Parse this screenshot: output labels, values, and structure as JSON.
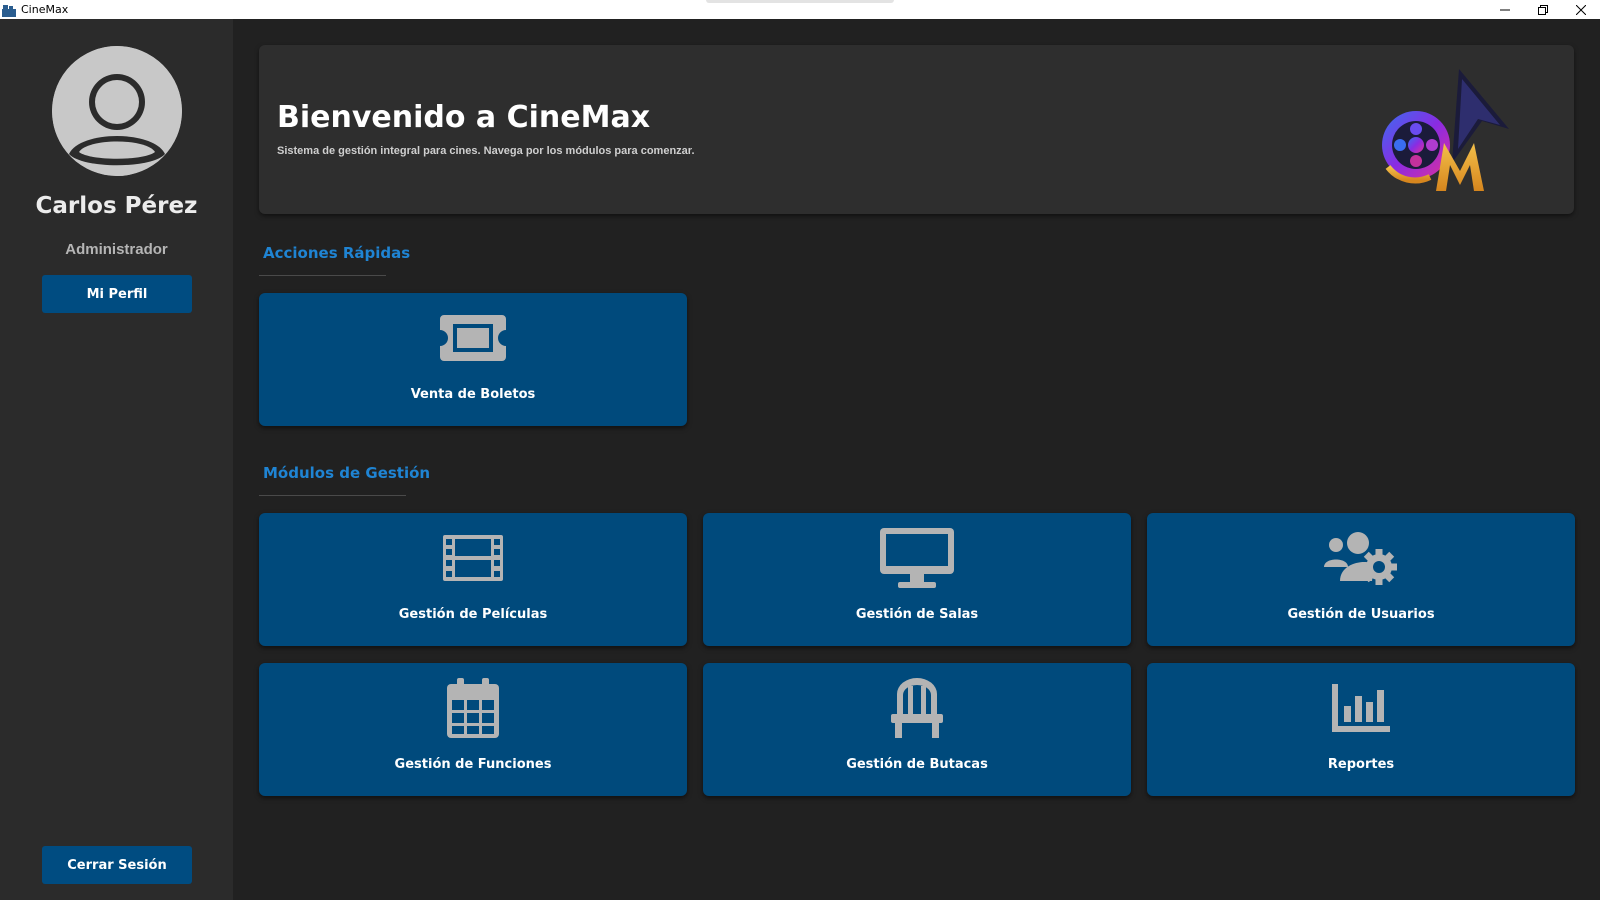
{
  "window": {
    "title": "CineMax",
    "icons": [
      "app-icon",
      "minimize-icon",
      "restore-icon",
      "close-icon"
    ]
  },
  "sidebar": {
    "user_name": "Carlos Pérez",
    "user_role": "Administrador",
    "profile_button": "Mi Perfil",
    "logout_button": "Cerrar Sesión"
  },
  "banner": {
    "title": "Bienvenido a CineMax",
    "subtitle": "Sistema de gestión integral para cines. Navega por los módulos para comenzar."
  },
  "quick_actions": {
    "title": "Acciones Rápidas",
    "items": [
      {
        "label": "Venta de Boletos",
        "icon": "ticket-icon"
      }
    ]
  },
  "modules": {
    "title": "Módulos de Gestión",
    "items": [
      {
        "label": "Gestión de Películas",
        "icon": "film-icon"
      },
      {
        "label": "Gestión de Salas",
        "icon": "monitor-icon"
      },
      {
        "label": "Gestión de Usuarios",
        "icon": "users-cog-icon"
      },
      {
        "label": "Gestión de Funciones",
        "icon": "calendar-icon"
      },
      {
        "label": "Gestión de Butacas",
        "icon": "chair-icon"
      },
      {
        "label": "Reportes",
        "icon": "bar-chart-icon"
      }
    ]
  },
  "colors": {
    "background": "#212121",
    "sidebar": "#2b2b2b",
    "card": "#004a7c",
    "accent": "#1f84d3",
    "icon": "#b4b4b4"
  }
}
